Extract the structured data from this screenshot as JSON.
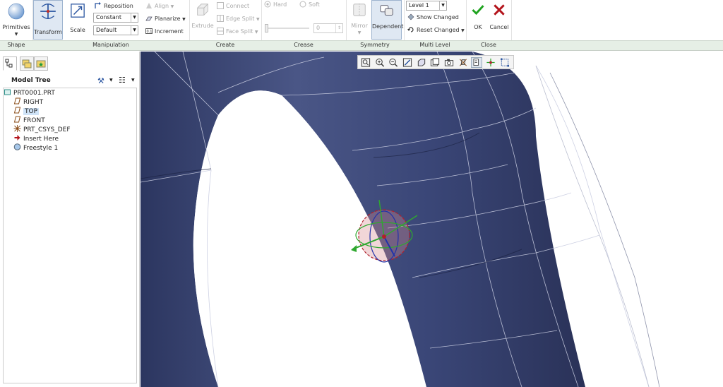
{
  "ribbon": {
    "primitives_label": "Primitives",
    "transform_label": "Transform",
    "scale_label": "Scale",
    "reposition_label": "Reposition",
    "constant_value": "Constant",
    "default_value": "Default",
    "align_label": "Align",
    "planarize_label": "Planarize",
    "increment_label": "Increment",
    "extrude_label": "Extrude",
    "connect_label": "Connect",
    "edge_split_label": "Edge Split",
    "face_split_label": "Face Split",
    "hard_label": "Hard",
    "soft_label": "Soft",
    "crease_value": "0",
    "mirror_label": "Mirror",
    "dependent_label": "Dependent",
    "level_value": "Level 1",
    "show_changed_label": "Show Changed",
    "reset_changed_label": "Reset Changed",
    "ok_label": "OK",
    "cancel_label": "Cancel"
  },
  "groups": {
    "shape": "Shape",
    "manipulation": "Manipulation",
    "create": "Create",
    "crease": "Crease",
    "symmetry": "Symmetry",
    "multi_level": "Multi Level",
    "close": "Close"
  },
  "tree": {
    "title": "Model Tree",
    "items": [
      {
        "label": "PRT0001.PRT",
        "icon": "part-icon"
      },
      {
        "label": "RIGHT",
        "icon": "datum-plane-icon"
      },
      {
        "label": "TOP",
        "icon": "datum-plane-icon"
      },
      {
        "label": "FRONT",
        "icon": "datum-plane-icon"
      },
      {
        "label": "PRT_CSYS_DEF",
        "icon": "csys-icon"
      },
      {
        "label": "Insert Here",
        "icon": "insert-arrow-icon"
      },
      {
        "label": "Freestyle 1",
        "icon": "freestyle-icon"
      }
    ]
  },
  "colors": {
    "model": "#3e4a7a",
    "accent_green": "#1fa31f",
    "cancel_red": "#b3121a",
    "selected": "#cfe3f7"
  }
}
